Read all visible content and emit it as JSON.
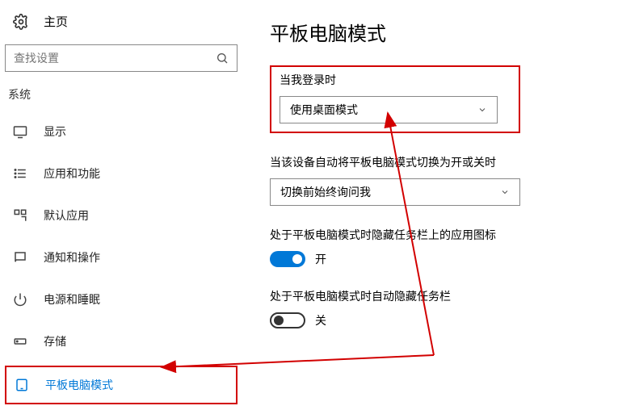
{
  "sidebar": {
    "home_label": "主页",
    "search_placeholder": "查找设置",
    "category": "系统",
    "items": [
      {
        "label": "显示"
      },
      {
        "label": "应用和功能"
      },
      {
        "label": "默认应用"
      },
      {
        "label": "通知和操作"
      },
      {
        "label": "电源和睡眠"
      },
      {
        "label": "存储"
      },
      {
        "label": "平板电脑模式"
      }
    ]
  },
  "main": {
    "title": "平板电脑模式",
    "group1": {
      "label": "当我登录时",
      "value": "使用桌面模式"
    },
    "group2": {
      "label": "当该设备自动将平板电脑模式切换为开或关时",
      "value": "切换前始终询问我"
    },
    "group3": {
      "label": "处于平板电脑模式时隐藏任务栏上的应用图标",
      "toggle_state": "on",
      "toggle_text": "开"
    },
    "group4": {
      "label": "处于平板电脑模式时自动隐藏任务栏",
      "toggle_state": "off",
      "toggle_text": "关"
    }
  }
}
